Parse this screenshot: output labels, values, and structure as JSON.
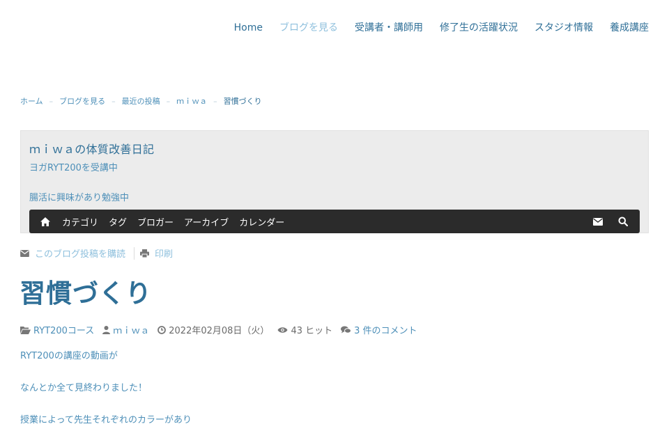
{
  "nav": {
    "items": [
      {
        "label": "Home"
      },
      {
        "label": "ブログを見る",
        "active": true
      },
      {
        "label": "受講者・講師用"
      },
      {
        "label": "修了生の活躍状況"
      },
      {
        "label": "スタジオ情報"
      },
      {
        "label": "養成講座"
      }
    ]
  },
  "breadcrumb": {
    "items": [
      "ホーム",
      "ブログを見る",
      "最近の投稿",
      "ｍｉｗａ"
    ],
    "current": "習慣づくり",
    "separator": "–"
  },
  "blog": {
    "title": "ｍｉｗａの体質改善日記",
    "subtitle1": "ヨガRYT200を受講中",
    "subtitle2": "腸活に興味があり勉強中",
    "toolbar": {
      "home_icon": "home-icon",
      "items": [
        "カテゴリ",
        "タグ",
        "ブロガー",
        "アーカイブ",
        "カレンダー"
      ],
      "right_icons": [
        "envelope-icon",
        "search-icon"
      ]
    }
  },
  "actions": {
    "subscribe": "このブログ投稿を購読",
    "print": "印刷"
  },
  "post": {
    "title": "習慣づくり",
    "meta": {
      "category": "RYT200コース",
      "author": "ｍｉｗａ",
      "date": "2022年02月08日（火）",
      "hits": "43 ヒット",
      "comments": "3 件のコメント"
    },
    "paragraphs": [
      "RYT200の講座の動画が",
      "なんとか全て見終わりました！",
      "授業によって先生それぞれのカラーがあり"
    ]
  },
  "colors": {
    "link": "#2f6f97",
    "link_light": "#8fc0dd",
    "toolbar_bg": "#2b2b2b",
    "header_bg": "#ececec"
  }
}
